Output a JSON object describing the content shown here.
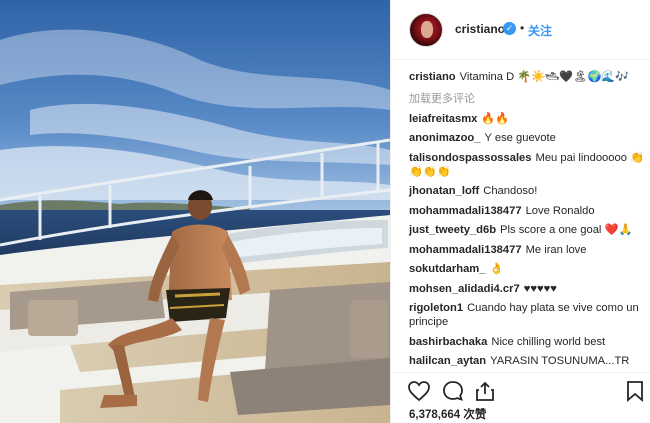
{
  "post": {
    "author": "cristiano",
    "follow_label": "关注",
    "caption_user": "cristiano",
    "caption_text": "Vitamina D 🌴☀️🛥🖤🏝🌍🌊🎶",
    "load_more": "加载更多评论",
    "likes": "6,378,664 次赞"
  },
  "comments": [
    {
      "user": "leiafreitasmx",
      "text": "🔥🔥"
    },
    {
      "user": "anonimazoo_",
      "text": "Y ese guevote"
    },
    {
      "user": "talisondospassossales",
      "text": "Meu pai lindooooo 👏👏👏👏"
    },
    {
      "user": "jhonatan_loff",
      "text": "Chandoso!"
    },
    {
      "user": "mohammadali138477",
      "text": "Love Ronaldo"
    },
    {
      "user": "just_tweety_d6b",
      "text": "Pls score a one goal ❤️🙏"
    },
    {
      "user": "mohammadali138477",
      "text": "Me iran love"
    },
    {
      "user": "sokutdarham_",
      "text": "👌"
    },
    {
      "user": "mohsen_alidadi4.cr7",
      "text": "♥♥♥♥♥"
    },
    {
      "user": "rigoleton1",
      "text": "Cuando hay plata se vive como un principe"
    },
    {
      "user": "bashirbachaka",
      "text": "Nice chilling world best"
    },
    {
      "user": "halilcan_aytan",
      "text": "YARASIN TOSUNUMA...TR"
    }
  ],
  "icons": [
    "heart-icon",
    "comment-icon",
    "share-icon",
    "bookmark-icon",
    "verified-icon"
  ],
  "colors": {
    "accent": "#3897f0",
    "text": "#262626",
    "muted": "#999999",
    "border": "#efefef"
  }
}
